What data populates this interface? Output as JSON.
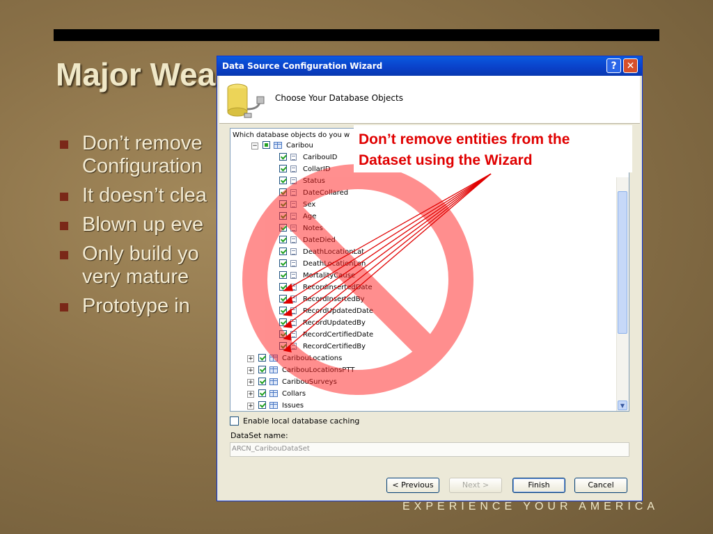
{
  "slide": {
    "title": "Major Wea",
    "bullets": [
      "Don’t remove",
      "Configuration",
      "It doesn’t clea",
      "Blown up eve",
      "Only build yo",
      "very mature",
      "Prototype in"
    ],
    "footer": "EXPERIENCE  YOUR  AMERICA"
  },
  "dialog": {
    "title": "Data Source Configuration Wizard",
    "help_label": "?",
    "close_label": "✕",
    "header_title": "Choose Your Database Objects",
    "tree_label": "Which database objects do you w",
    "tree": {
      "root": "Caribou",
      "columns": [
        "CaribouID",
        "CollarID",
        "Status",
        "DateCollared",
        "Sex",
        "Age",
        "Notes",
        "DateDied",
        "DeathLocationLat",
        "DeathLocationLon",
        "MortalityCause",
        "RecordInsertedDate",
        "RecordInsertedBy",
        "RecordUpdatedDate",
        "RecordUpdatedBy",
        "RecordCertifiedDate",
        "RecordCertifiedBy"
      ],
      "tables": [
        "CaribouLocations",
        "CaribouLocationsPTT",
        "CaribouSurveys",
        "Collars",
        "Issues"
      ]
    },
    "cache_label": "Enable local database caching",
    "dataset_label": "DataSet name:",
    "dataset_value": "ARCN_CaribouDataSet",
    "buttons": {
      "previous": "< Previous",
      "next": "Next >",
      "finish": "Finish",
      "cancel": "Cancel"
    }
  },
  "annotation": {
    "line1": "Don’t remove entities from the",
    "line2": "Dataset using the Wizard"
  },
  "colors": {
    "prohibition": "#ff2020",
    "annotation_text": "#e00000",
    "titlebar": "#0a48d0",
    "footer_text": "#f0e8c8"
  }
}
